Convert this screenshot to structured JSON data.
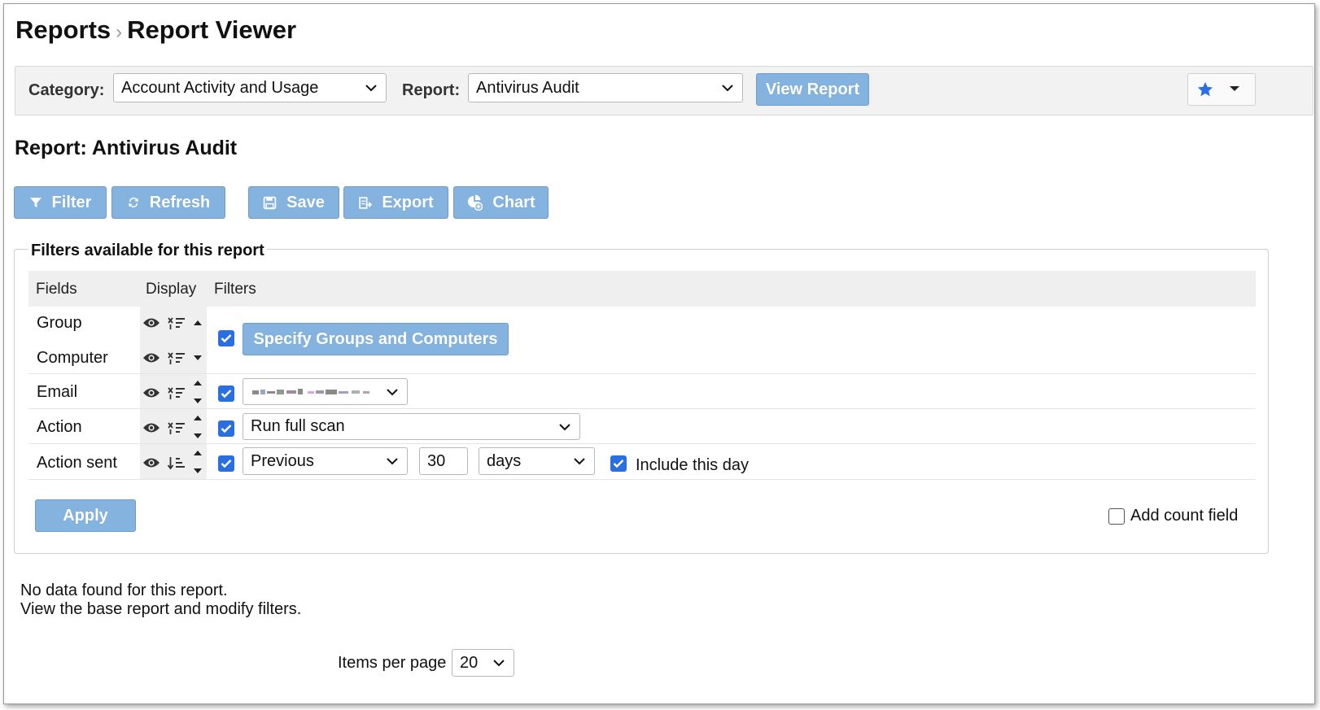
{
  "breadcrumb": {
    "root": "Reports",
    "separator": "›",
    "current": "Report Viewer"
  },
  "toolbar": {
    "category_label": "Category:",
    "category_value": "Account Activity and Usage",
    "report_label": "Report:",
    "report_value": "Antivirus Audit",
    "view_report_label": "View Report",
    "favorite_icon": "star-icon"
  },
  "report_title": "Report: Antivirus Audit",
  "actions": {
    "filter": "Filter",
    "refresh": "Refresh",
    "save": "Save",
    "export": "Export",
    "chart": "Chart"
  },
  "filters_panel": {
    "legend": "Filters available for this report",
    "columns": [
      "Fields",
      "Display",
      "Filters"
    ],
    "rows": [
      {
        "field": "Group"
      },
      {
        "field": "Computer"
      },
      {
        "field": "Email"
      },
      {
        "field": "Action"
      },
      {
        "field": "Action sent"
      }
    ],
    "group_button": "Specify Groups and Computers",
    "action_value": "Run full scan",
    "period_value": "Previous",
    "period_count": "30",
    "period_unit": "days",
    "include_day_label": "Include this day",
    "apply_label": "Apply",
    "add_count_label": "Add count field"
  },
  "empty_state": {
    "line1": "No data found for this report.",
    "line2": "View the base report and modify filters."
  },
  "pagination": {
    "label": "Items per page",
    "value": "20"
  },
  "colors": {
    "button_bg": "#84b3e0",
    "checkbox": "#2a6fe0",
    "header_bg": "#efefef"
  }
}
